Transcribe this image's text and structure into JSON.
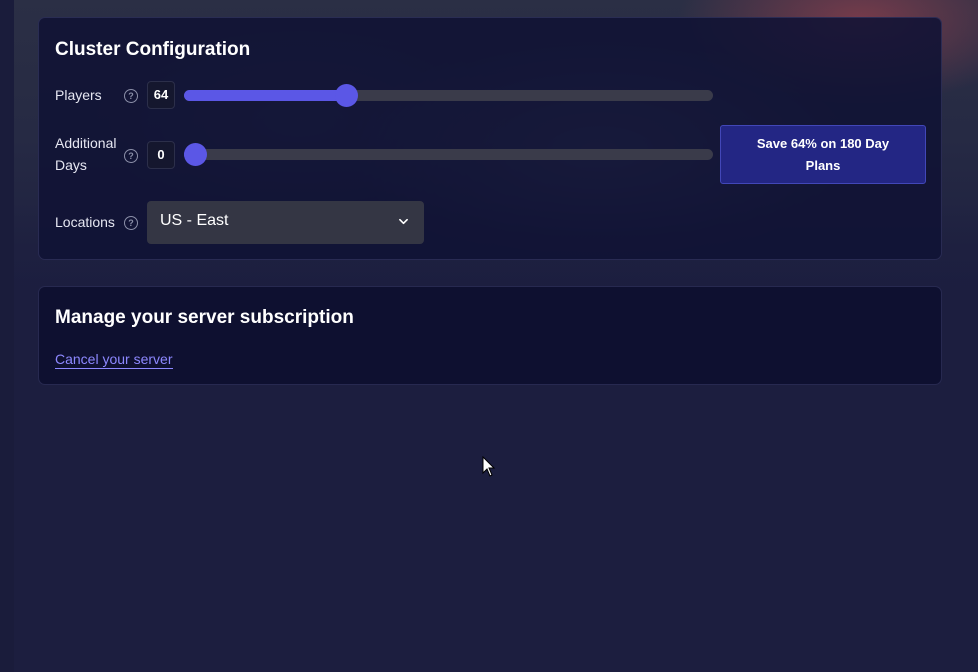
{
  "config": {
    "title": "Cluster Configuration",
    "players": {
      "label": "Players",
      "value": "64",
      "fraction": 0.298
    },
    "days": {
      "label_line1": "Additional",
      "label_line2": "Days",
      "value": "0",
      "fraction": 0.0
    },
    "promo": {
      "line1": "Save 64% on 180 Day",
      "line2": "Plans"
    },
    "locations": {
      "label": "Locations",
      "selected": "US - East"
    },
    "help_glyph": "?"
  },
  "manage": {
    "title": "Manage your server subscription",
    "cancel_link": "Cancel your server"
  },
  "colors": {
    "accent": "#5b57e6",
    "link": "#8d88ff",
    "page_bg": "#1c1e3f",
    "card_bg": "#101234",
    "promo_bg": "#232684"
  },
  "icons": {
    "help": "help-circle-icon",
    "chevron": "chevron-down-icon",
    "cursor": "mouse-pointer-icon"
  }
}
